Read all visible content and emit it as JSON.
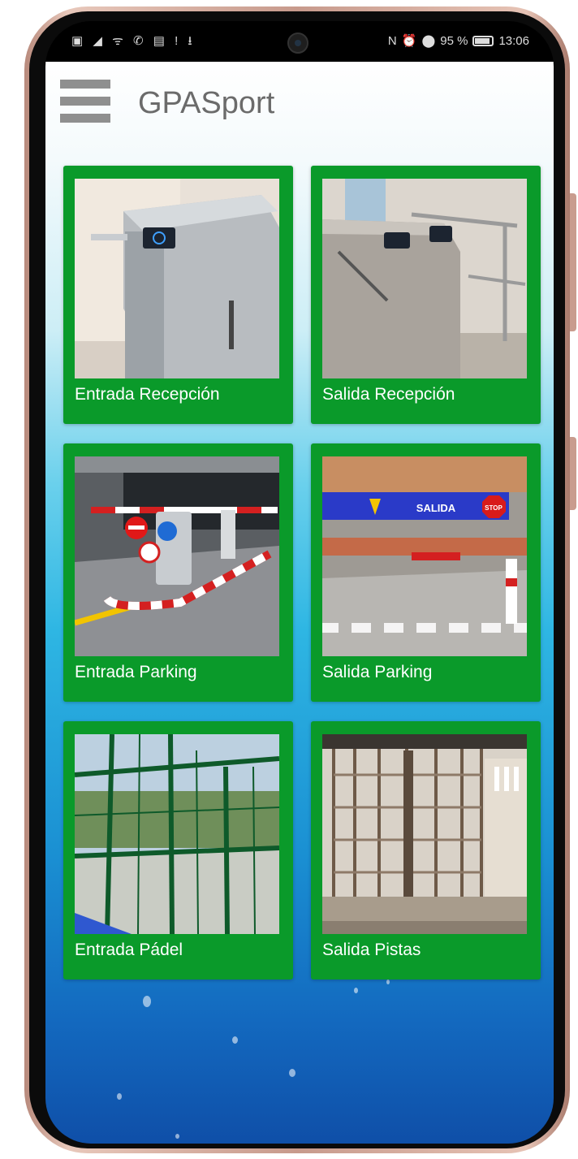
{
  "status_bar": {
    "left_icons": [
      "sim-icon",
      "signal-icon",
      "wifi-icon",
      "whatsapp-icon",
      "message-icon",
      "alert-icon",
      "download-icon"
    ],
    "nfc": "N",
    "battery": "95 %",
    "time": "13:06"
  },
  "app": {
    "title": "GPASport",
    "tiles": [
      {
        "label": "Entrada Recepción"
      },
      {
        "label": "Salida Recepción"
      },
      {
        "label": "Entrada Parking"
      },
      {
        "label": "Salida Parking"
      },
      {
        "label": "Entrada Pádel"
      },
      {
        "label": "Salida Pistas"
      }
    ],
    "parking_sign": "SALIDA",
    "stop_sign": "STOP"
  },
  "colors": {
    "tile_green": "#0a9a2a",
    "title_gray": "#6b6b6b",
    "gradient_top": "#ffffff",
    "gradient_bottom": "#0f4fa8"
  }
}
